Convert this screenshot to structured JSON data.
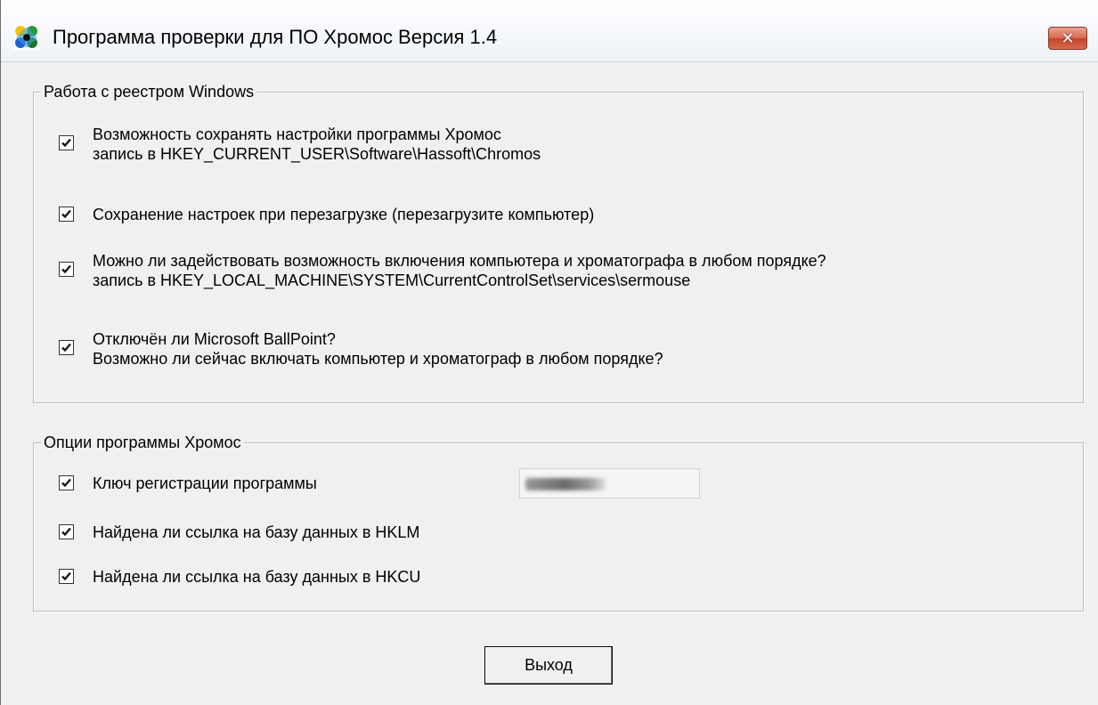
{
  "window": {
    "title": "Программа проверки для ПО Хромос  Версия 1.4",
    "close_symbol": "✕"
  },
  "registry_group": {
    "legend": "Работа с реестром Windows",
    "items": [
      {
        "checked": true,
        "line1": "Возможность сохранять настройки программы Хромос",
        "line2": "запись в  HKEY_CURRENT_USER\\Software\\Hassoft\\Chromos"
      },
      {
        "checked": true,
        "line1": "Сохранение настроек при перезагрузке (перезагрузите компьютер)"
      },
      {
        "checked": true,
        "line1": "Можно ли задействовать возможность включения компьютера и хроматографа в любом порядке?",
        "line2": "запись в  HKEY_LOCAL_MACHINE\\SYSTEM\\CurrentControlSet\\services\\sermouse"
      },
      {
        "checked": true,
        "line1": "Отключён ли Microsoft BallPoint?",
        "line2": "Возможно ли сейчас включать компьютер и хроматограф в любом порядке?"
      }
    ]
  },
  "options_group": {
    "legend": "Опции программы Хромос",
    "items": [
      {
        "checked": true,
        "line1": "Ключ регистрации программы"
      },
      {
        "checked": true,
        "line1": "Найдена ли ссылка на базу данных в HKLM"
      },
      {
        "checked": true,
        "line1": "Найдена ли ссылка на базу данных в HKCU"
      }
    ]
  },
  "exit_button": {
    "label": "Выход"
  },
  "icons": {
    "app": "chromos-app-icon",
    "check": "checkmark-icon",
    "close": "close-icon"
  }
}
